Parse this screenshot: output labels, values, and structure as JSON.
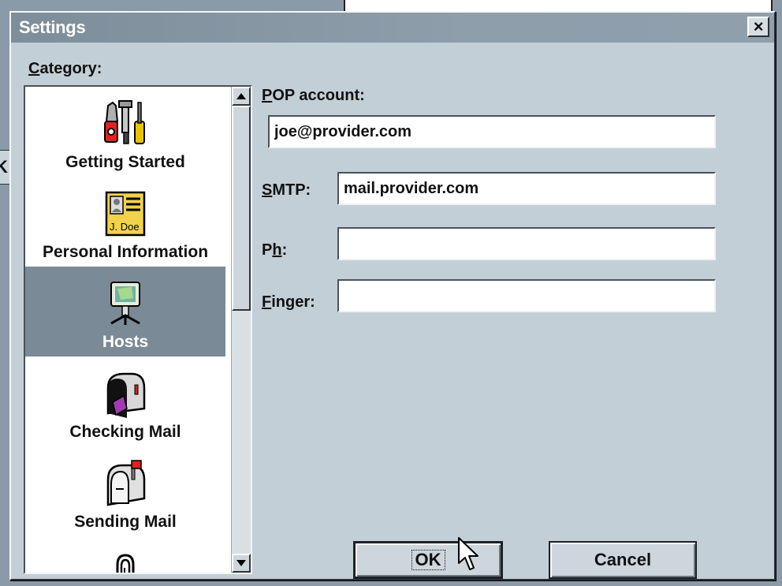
{
  "dialog": {
    "title": "Settings",
    "close_label": "×"
  },
  "category": {
    "label_underlined": "C",
    "label_rest": "ategory:",
    "items": [
      {
        "label": "Getting Started",
        "icon": "tools-icon"
      },
      {
        "label": "Personal Information",
        "icon": "id-card-icon",
        "icon_text": "J. Doe"
      },
      {
        "label": "Hosts",
        "icon": "computer-host-icon",
        "selected": true
      },
      {
        "label": "Checking Mail",
        "icon": "mailbox-open-icon"
      },
      {
        "label": "Sending Mail",
        "icon": "mailbox-flag-icon"
      },
      {
        "label": "",
        "icon": "paperclip-icon"
      }
    ]
  },
  "fields": {
    "pop": {
      "label_underlined": "P",
      "label_rest": "OP account:",
      "value": "joe@provider.com"
    },
    "smtp": {
      "label_underlined": "S",
      "label_rest": "MTP:",
      "value": "mail.provider.com"
    },
    "ph": {
      "label_pre": "P",
      "label_underlined": "h",
      "label_rest": ":",
      "value": ""
    },
    "finger": {
      "label_underlined": "F",
      "label_rest": "inger:",
      "value": ""
    }
  },
  "buttons": {
    "ok": "OK",
    "cancel": "Cancel"
  },
  "background": {
    "fragment_text": "K"
  }
}
